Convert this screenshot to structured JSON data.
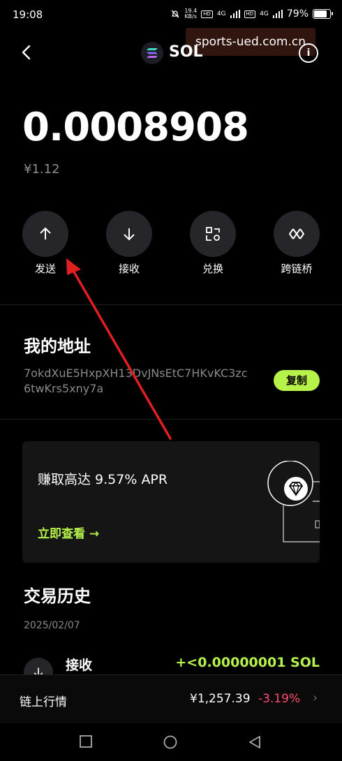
{
  "status_bar": {
    "time": "19:08",
    "net_speed_top": "19.4",
    "net_speed_bottom": "KB/s",
    "hd1": "HD",
    "g1": "4G",
    "hd2": "HD",
    "g2": "4G",
    "battery": "79%",
    "battery_level": 0.79
  },
  "watermark": "sports-ued.com.cn",
  "header": {
    "title": "SOL",
    "info_label": "i"
  },
  "balance": {
    "amount": "0.0008908",
    "fiat": "¥1.12"
  },
  "actions": [
    {
      "label": "发送",
      "icon": "arrow-up-icon"
    },
    {
      "label": "接收",
      "icon": "arrow-down-icon"
    },
    {
      "label": "兑换",
      "icon": "swap-grid-icon"
    },
    {
      "label": "跨链桥",
      "icon": "bridge-icon"
    }
  ],
  "address": {
    "title": "我的地址",
    "value": "7okdXuE5HxpXH13DvJNsEtC7HKvKC3zc6twKrs5xny7a",
    "copy_label": "复制"
  },
  "promo": {
    "text": "赚取高达 9.57% APR",
    "link": "立即查看 →"
  },
  "history": {
    "title": "交易历史",
    "date": "2025/02/07",
    "items": [
      {
        "type": "接收",
        "amount": "+<0.00000001 SOL"
      }
    ]
  },
  "market": {
    "title": "链上行情",
    "price": "¥1,257.39",
    "change": "-3.19%",
    "chevron": "›"
  },
  "colors": {
    "accent": "#b6f24a",
    "negative": "#ff4d6d",
    "background": "#000000",
    "annotation_arrow": "#e02020"
  }
}
